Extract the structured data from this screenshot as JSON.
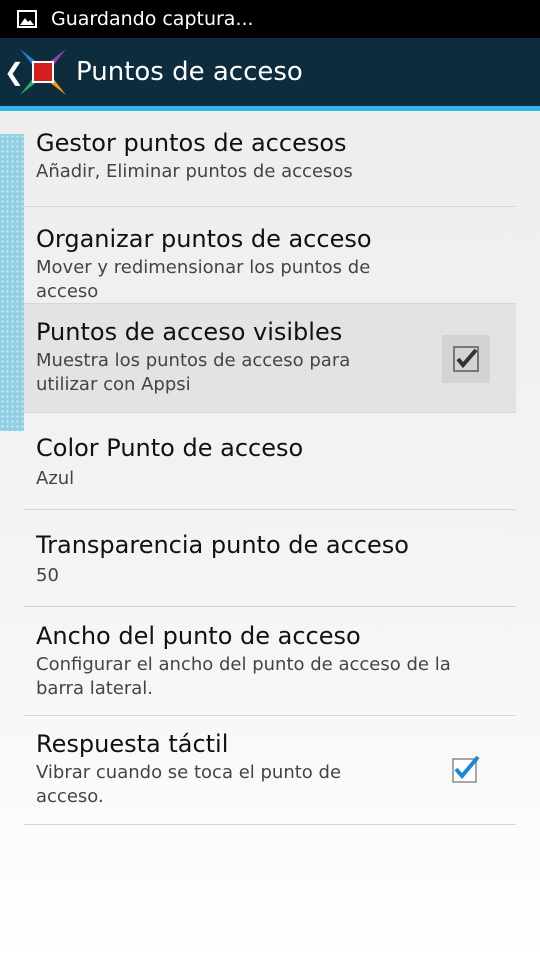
{
  "status_bar": {
    "notification_text": "Guardando captura...",
    "icon": "image-icon"
  },
  "action_bar": {
    "back_icon": "chevron-left-icon",
    "logo_icon": "appsi-logo-icon",
    "title": "Puntos de acceso"
  },
  "colors": {
    "action_bar_bg": "#0d2d3e",
    "accent": "#33b5e5",
    "side_strip": "#8ecfe3",
    "selected_row_bg": "#e3e3e3",
    "checkbox_check": "#1e88d6"
  },
  "settings": {
    "items": [
      {
        "title": "Gestor puntos de accesos",
        "summary": "Añadir, Eliminar puntos de accesos"
      },
      {
        "title": "Organizar puntos de acceso",
        "summary": "Mover y redimensionar los puntos de acceso"
      },
      {
        "title": "Puntos de acceso visibles",
        "summary_line1": "Muestra los puntos de acceso para",
        "summary_line2": "utilizar con Appsi",
        "checked": true,
        "pressed": true
      },
      {
        "title": "Color Punto de acceso",
        "summary": "Azul"
      },
      {
        "title": "Transparencia punto de acceso",
        "summary": "50"
      },
      {
        "title": "Ancho del punto de acceso",
        "summary_line1": "Configurar el ancho del punto de acceso de la",
        "summary_line2": "barra lateral."
      },
      {
        "title": "Respuesta táctil",
        "summary_line1": "Vibrar cuando se toca el punto de",
        "summary_line2": "acceso.",
        "checked": true
      }
    ]
  }
}
